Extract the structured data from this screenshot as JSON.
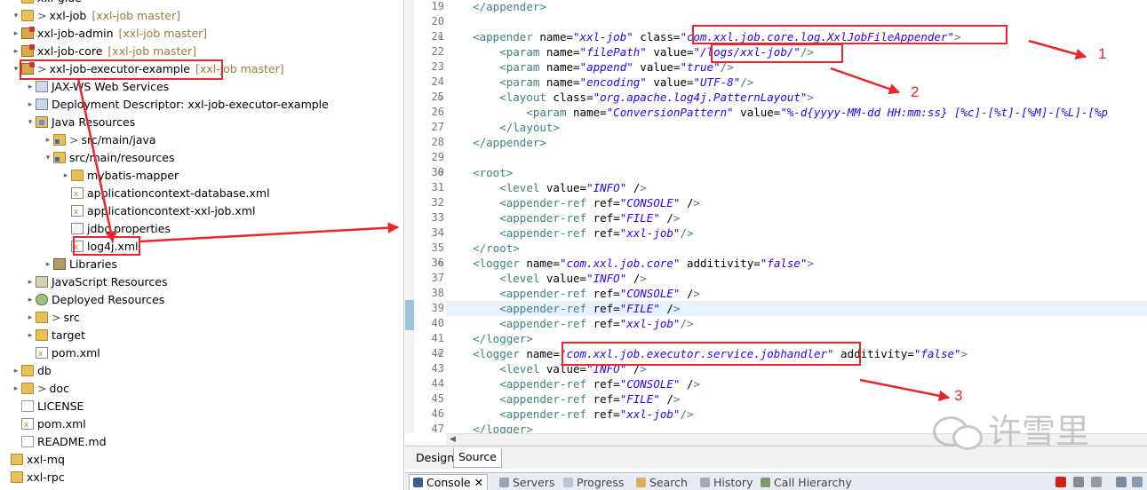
{
  "tree": {
    "rows": [
      {
        "label": "xxl-glue",
        "extra": ""
      },
      {
        "label": "xxl-job",
        "extra": "[xxl-job master]",
        "prefix": ">"
      },
      {
        "label": "xxl-job-admin",
        "extra": "[xxl-job master]"
      },
      {
        "label": "xxl-job-core",
        "extra": "[xxl-job master]"
      },
      {
        "label": "xxl-job-executor-example",
        "extra": "[xxl-job master]",
        "prefix": ">"
      },
      {
        "label": "JAX-WS Web Services",
        "extra": ""
      },
      {
        "label": "Deployment Descriptor: xxl-job-executor-example",
        "extra": ""
      },
      {
        "label": "Java Resources",
        "extra": ""
      },
      {
        "label": "src/main/java",
        "extra": "",
        "prefix": ">"
      },
      {
        "label": "src/main/resources",
        "extra": ""
      },
      {
        "label": "mybatis-mapper",
        "extra": ""
      },
      {
        "label": "applicationcontext-database.xml",
        "extra": ""
      },
      {
        "label": "applicationcontext-xxl-job.xml",
        "extra": ""
      },
      {
        "label": "jdbc.properties",
        "extra": ""
      },
      {
        "label": "log4j.xml",
        "extra": ""
      },
      {
        "label": "Libraries",
        "extra": ""
      },
      {
        "label": "JavaScript Resources",
        "extra": ""
      },
      {
        "label": "Deployed Resources",
        "extra": ""
      },
      {
        "label": "src",
        "extra": "",
        "prefix": ">"
      },
      {
        "label": "target",
        "extra": ""
      },
      {
        "label": "pom.xml",
        "extra": ""
      },
      {
        "label": "db",
        "extra": ""
      },
      {
        "label": "doc",
        "extra": "",
        "prefix": ">"
      },
      {
        "label": "LICENSE",
        "extra": ""
      },
      {
        "label": "pom.xml",
        "extra": ""
      },
      {
        "label": "README.md",
        "extra": ""
      },
      {
        "label": "xxl-mq",
        "extra": ""
      },
      {
        "label": "xxl-rpc",
        "extra": ""
      }
    ]
  },
  "editor": {
    "line_numbers": [
      "19",
      "20",
      "21",
      "22",
      "23",
      "24",
      "25",
      "26",
      "27",
      "28",
      "29",
      "30",
      "31",
      "32",
      "33",
      "34",
      "35",
      "36",
      "37",
      "38",
      "39",
      "40",
      "41",
      "42",
      "43",
      "44",
      "45",
      "46",
      "47"
    ],
    "lines": [
      "    </appender>",
      "",
      "    <appender name=\"xxl-job\" class=\"com.xxl.job.core.log.XxlJobFileAppender\">",
      "        <param name=\"filePath\" value=\"/logs/xxl-job/\"/>",
      "        <param name=\"append\" value=\"true\"/>",
      "        <param name=\"encoding\" value=\"UTF-8\"/>",
      "        <layout class=\"org.apache.log4j.PatternLayout\">",
      "            <param name=\"ConversionPattern\" value=\"%-d{yyyy-MM-dd HH:mm:ss} [%c]-[%t]-[%M]-[%L]-[%p",
      "        </layout>",
      "    </appender>",
      "",
      "    <root>",
      "        <level value=\"INFO\" />",
      "        <appender-ref ref=\"CONSOLE\" />",
      "        <appender-ref ref=\"FILE\" />",
      "        <appender-ref ref=\"xxl-job\"/>",
      "    </root>",
      "    <logger name=\"com.xxl.job.core\" additivity=\"false\">",
      "        <level value=\"INFO\" />",
      "        <appender-ref ref=\"CONSOLE\" />",
      "        <appender-ref ref=\"FILE\" />",
      "        <appender-ref ref=\"xxl-job\"/>",
      "    </logger>",
      "    <logger name=\"com.xxl.job.executor.service.jobhandler\" additivity=\"false\">",
      "        <level value=\"INFO\" />",
      "        <appender-ref ref=\"CONSOLE\" />",
      "        <appender-ref ref=\"FILE\" />",
      "        <appender-ref ref=\"xxl-job\"/>",
      "    </logger>"
    ],
    "fold_marks": [
      "",
      "",
      "⊖",
      "",
      "",
      "",
      "⊖",
      "",
      "",
      "",
      "",
      "⊖",
      "",
      "",
      "",
      "",
      "",
      "⊖",
      "",
      "",
      "",
      "",
      "",
      "⊖",
      "",
      "",
      "",
      "",
      ""
    ],
    "highlight_line": "39"
  },
  "editor_tabs": {
    "design": "Design",
    "source": "Source"
  },
  "views": {
    "console": "Console ✕",
    "servers": "Servers",
    "progress": "Progress",
    "search": "Search",
    "history": "History",
    "call_hierarchy": "Call Hierarchy"
  },
  "annotations": {
    "n1": "1",
    "n2": "2",
    "n3": "3"
  },
  "watermark": {
    "text": "许雪里"
  },
  "colors": {
    "annotation": "#e8262b",
    "xml_tag": "#3f7f7f",
    "xml_attr": "#7f007f",
    "xml_value": "#2a00ff"
  }
}
